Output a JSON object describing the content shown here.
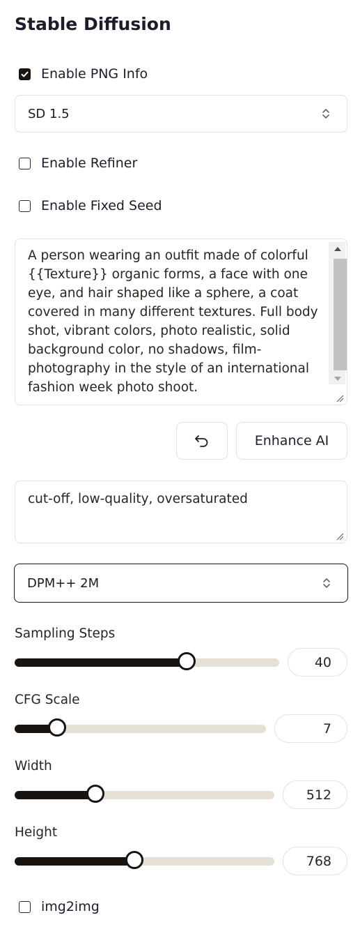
{
  "title": "Stable Diffusion",
  "enable_png_info": {
    "label": "Enable PNG Info",
    "checked": true
  },
  "model_select": {
    "value": "SD 1.5"
  },
  "enable_refiner": {
    "label": "Enable Refiner",
    "checked": false
  },
  "enable_fixed_seed": {
    "label": "Enable Fixed Seed",
    "checked": false
  },
  "prompt": {
    "value": "A person wearing an outfit made of colorful {{Texture}} organic forms, a face with one eye, and hair shaped like a sphere, a coat covered in many different textures. Full body shot, vibrant colors, photo realistic, solid background color, no shadows, film-photography in the style of an international fashion week photo shoot."
  },
  "undo_button": {
    "icon": "undo-icon"
  },
  "enhance_button": {
    "label": "Enhance AI"
  },
  "negative_prompt": {
    "value": "cut-off, low-quality, oversaturated"
  },
  "sampler_select": {
    "value": "DPM++ 2M"
  },
  "sliders": {
    "sampling_steps": {
      "label": "Sampling Steps",
      "value": "40",
      "fraction": 0.65
    },
    "cfg_scale": {
      "label": "CFG Scale",
      "value": "7",
      "fraction": 0.17
    },
    "width": {
      "label": "Width",
      "value": "512",
      "fraction": 0.31
    },
    "height": {
      "label": "Height",
      "value": "768",
      "fraction": 0.46
    }
  },
  "img2img": {
    "label": "img2img",
    "checked": false
  },
  "colors": {
    "accent": "#1a1411",
    "track": "#e6dfd5",
    "border": "#e4e2e0"
  }
}
